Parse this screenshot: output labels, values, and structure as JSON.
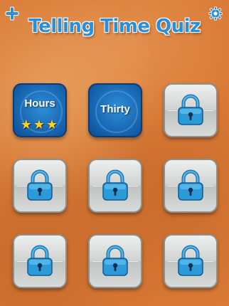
{
  "header": {
    "title": "Telling Time Quiz",
    "add_icon": "plus-icon",
    "settings_icon": "gear-icon"
  },
  "levels": [
    {
      "label": "Hours",
      "state": "unlocked",
      "stars": "★★★",
      "star_count": 3
    },
    {
      "label": "Thirty",
      "state": "unlocked",
      "stars": "",
      "star_count": 0
    },
    {
      "state": "locked",
      "icon": "padlock-icon"
    },
    {
      "state": "locked",
      "icon": "padlock-icon"
    },
    {
      "state": "locked",
      "icon": "padlock-icon"
    },
    {
      "state": "locked",
      "icon": "padlock-icon"
    },
    {
      "state": "locked",
      "icon": "padlock-icon"
    },
    {
      "state": "locked",
      "icon": "padlock-icon"
    },
    {
      "state": "locked",
      "icon": "padlock-icon"
    }
  ],
  "colors": {
    "background": "#d97a36",
    "title": "#2a8fd6",
    "unlocked_tile": "#1867b3",
    "locked_tile": "#cfd3d2",
    "lock": "#2a9ad8",
    "star": "#ffd21f"
  }
}
